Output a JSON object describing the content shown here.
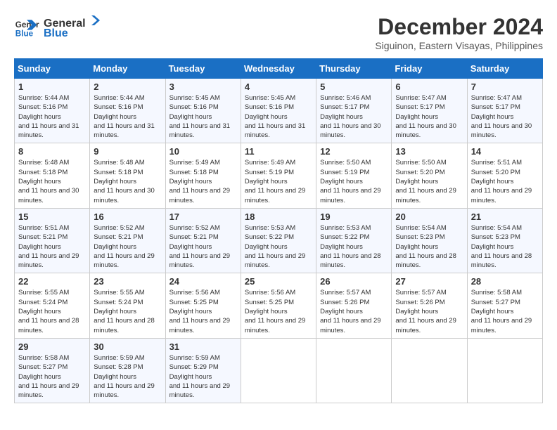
{
  "logo": {
    "line1": "General",
    "line2": "Blue"
  },
  "title": "December 2024",
  "location": "Siguinon, Eastern Visayas, Philippines",
  "headers": [
    "Sunday",
    "Monday",
    "Tuesday",
    "Wednesday",
    "Thursday",
    "Friday",
    "Saturday"
  ],
  "weeks": [
    [
      {
        "day": "1",
        "sunrise": "5:44 AM",
        "sunset": "5:16 PM",
        "daylight": "11 hours and 31 minutes."
      },
      {
        "day": "2",
        "sunrise": "5:44 AM",
        "sunset": "5:16 PM",
        "daylight": "11 hours and 31 minutes."
      },
      {
        "day": "3",
        "sunrise": "5:45 AM",
        "sunset": "5:16 PM",
        "daylight": "11 hours and 31 minutes."
      },
      {
        "day": "4",
        "sunrise": "5:45 AM",
        "sunset": "5:16 PM",
        "daylight": "11 hours and 31 minutes."
      },
      {
        "day": "5",
        "sunrise": "5:46 AM",
        "sunset": "5:17 PM",
        "daylight": "11 hours and 30 minutes."
      },
      {
        "day": "6",
        "sunrise": "5:47 AM",
        "sunset": "5:17 PM",
        "daylight": "11 hours and 30 minutes."
      },
      {
        "day": "7",
        "sunrise": "5:47 AM",
        "sunset": "5:17 PM",
        "daylight": "11 hours and 30 minutes."
      }
    ],
    [
      {
        "day": "8",
        "sunrise": "5:48 AM",
        "sunset": "5:18 PM",
        "daylight": "11 hours and 30 minutes."
      },
      {
        "day": "9",
        "sunrise": "5:48 AM",
        "sunset": "5:18 PM",
        "daylight": "11 hours and 30 minutes."
      },
      {
        "day": "10",
        "sunrise": "5:49 AM",
        "sunset": "5:18 PM",
        "daylight": "11 hours and 29 minutes."
      },
      {
        "day": "11",
        "sunrise": "5:49 AM",
        "sunset": "5:19 PM",
        "daylight": "11 hours and 29 minutes."
      },
      {
        "day": "12",
        "sunrise": "5:50 AM",
        "sunset": "5:19 PM",
        "daylight": "11 hours and 29 minutes."
      },
      {
        "day": "13",
        "sunrise": "5:50 AM",
        "sunset": "5:20 PM",
        "daylight": "11 hours and 29 minutes."
      },
      {
        "day": "14",
        "sunrise": "5:51 AM",
        "sunset": "5:20 PM",
        "daylight": "11 hours and 29 minutes."
      }
    ],
    [
      {
        "day": "15",
        "sunrise": "5:51 AM",
        "sunset": "5:21 PM",
        "daylight": "11 hours and 29 minutes."
      },
      {
        "day": "16",
        "sunrise": "5:52 AM",
        "sunset": "5:21 PM",
        "daylight": "11 hours and 29 minutes."
      },
      {
        "day": "17",
        "sunrise": "5:52 AM",
        "sunset": "5:21 PM",
        "daylight": "11 hours and 29 minutes."
      },
      {
        "day": "18",
        "sunrise": "5:53 AM",
        "sunset": "5:22 PM",
        "daylight": "11 hours and 29 minutes."
      },
      {
        "day": "19",
        "sunrise": "5:53 AM",
        "sunset": "5:22 PM",
        "daylight": "11 hours and 28 minutes."
      },
      {
        "day": "20",
        "sunrise": "5:54 AM",
        "sunset": "5:23 PM",
        "daylight": "11 hours and 28 minutes."
      },
      {
        "day": "21",
        "sunrise": "5:54 AM",
        "sunset": "5:23 PM",
        "daylight": "11 hours and 28 minutes."
      }
    ],
    [
      {
        "day": "22",
        "sunrise": "5:55 AM",
        "sunset": "5:24 PM",
        "daylight": "11 hours and 28 minutes."
      },
      {
        "day": "23",
        "sunrise": "5:55 AM",
        "sunset": "5:24 PM",
        "daylight": "11 hours and 28 minutes."
      },
      {
        "day": "24",
        "sunrise": "5:56 AM",
        "sunset": "5:25 PM",
        "daylight": "11 hours and 29 minutes."
      },
      {
        "day": "25",
        "sunrise": "5:56 AM",
        "sunset": "5:25 PM",
        "daylight": "11 hours and 29 minutes."
      },
      {
        "day": "26",
        "sunrise": "5:57 AM",
        "sunset": "5:26 PM",
        "daylight": "11 hours and 29 minutes."
      },
      {
        "day": "27",
        "sunrise": "5:57 AM",
        "sunset": "5:26 PM",
        "daylight": "11 hours and 29 minutes."
      },
      {
        "day": "28",
        "sunrise": "5:58 AM",
        "sunset": "5:27 PM",
        "daylight": "11 hours and 29 minutes."
      }
    ],
    [
      {
        "day": "29",
        "sunrise": "5:58 AM",
        "sunset": "5:27 PM",
        "daylight": "11 hours and 29 minutes."
      },
      {
        "day": "30",
        "sunrise": "5:59 AM",
        "sunset": "5:28 PM",
        "daylight": "11 hours and 29 minutes."
      },
      {
        "day": "31",
        "sunrise": "5:59 AM",
        "sunset": "5:29 PM",
        "daylight": "11 hours and 29 minutes."
      },
      null,
      null,
      null,
      null
    ]
  ]
}
